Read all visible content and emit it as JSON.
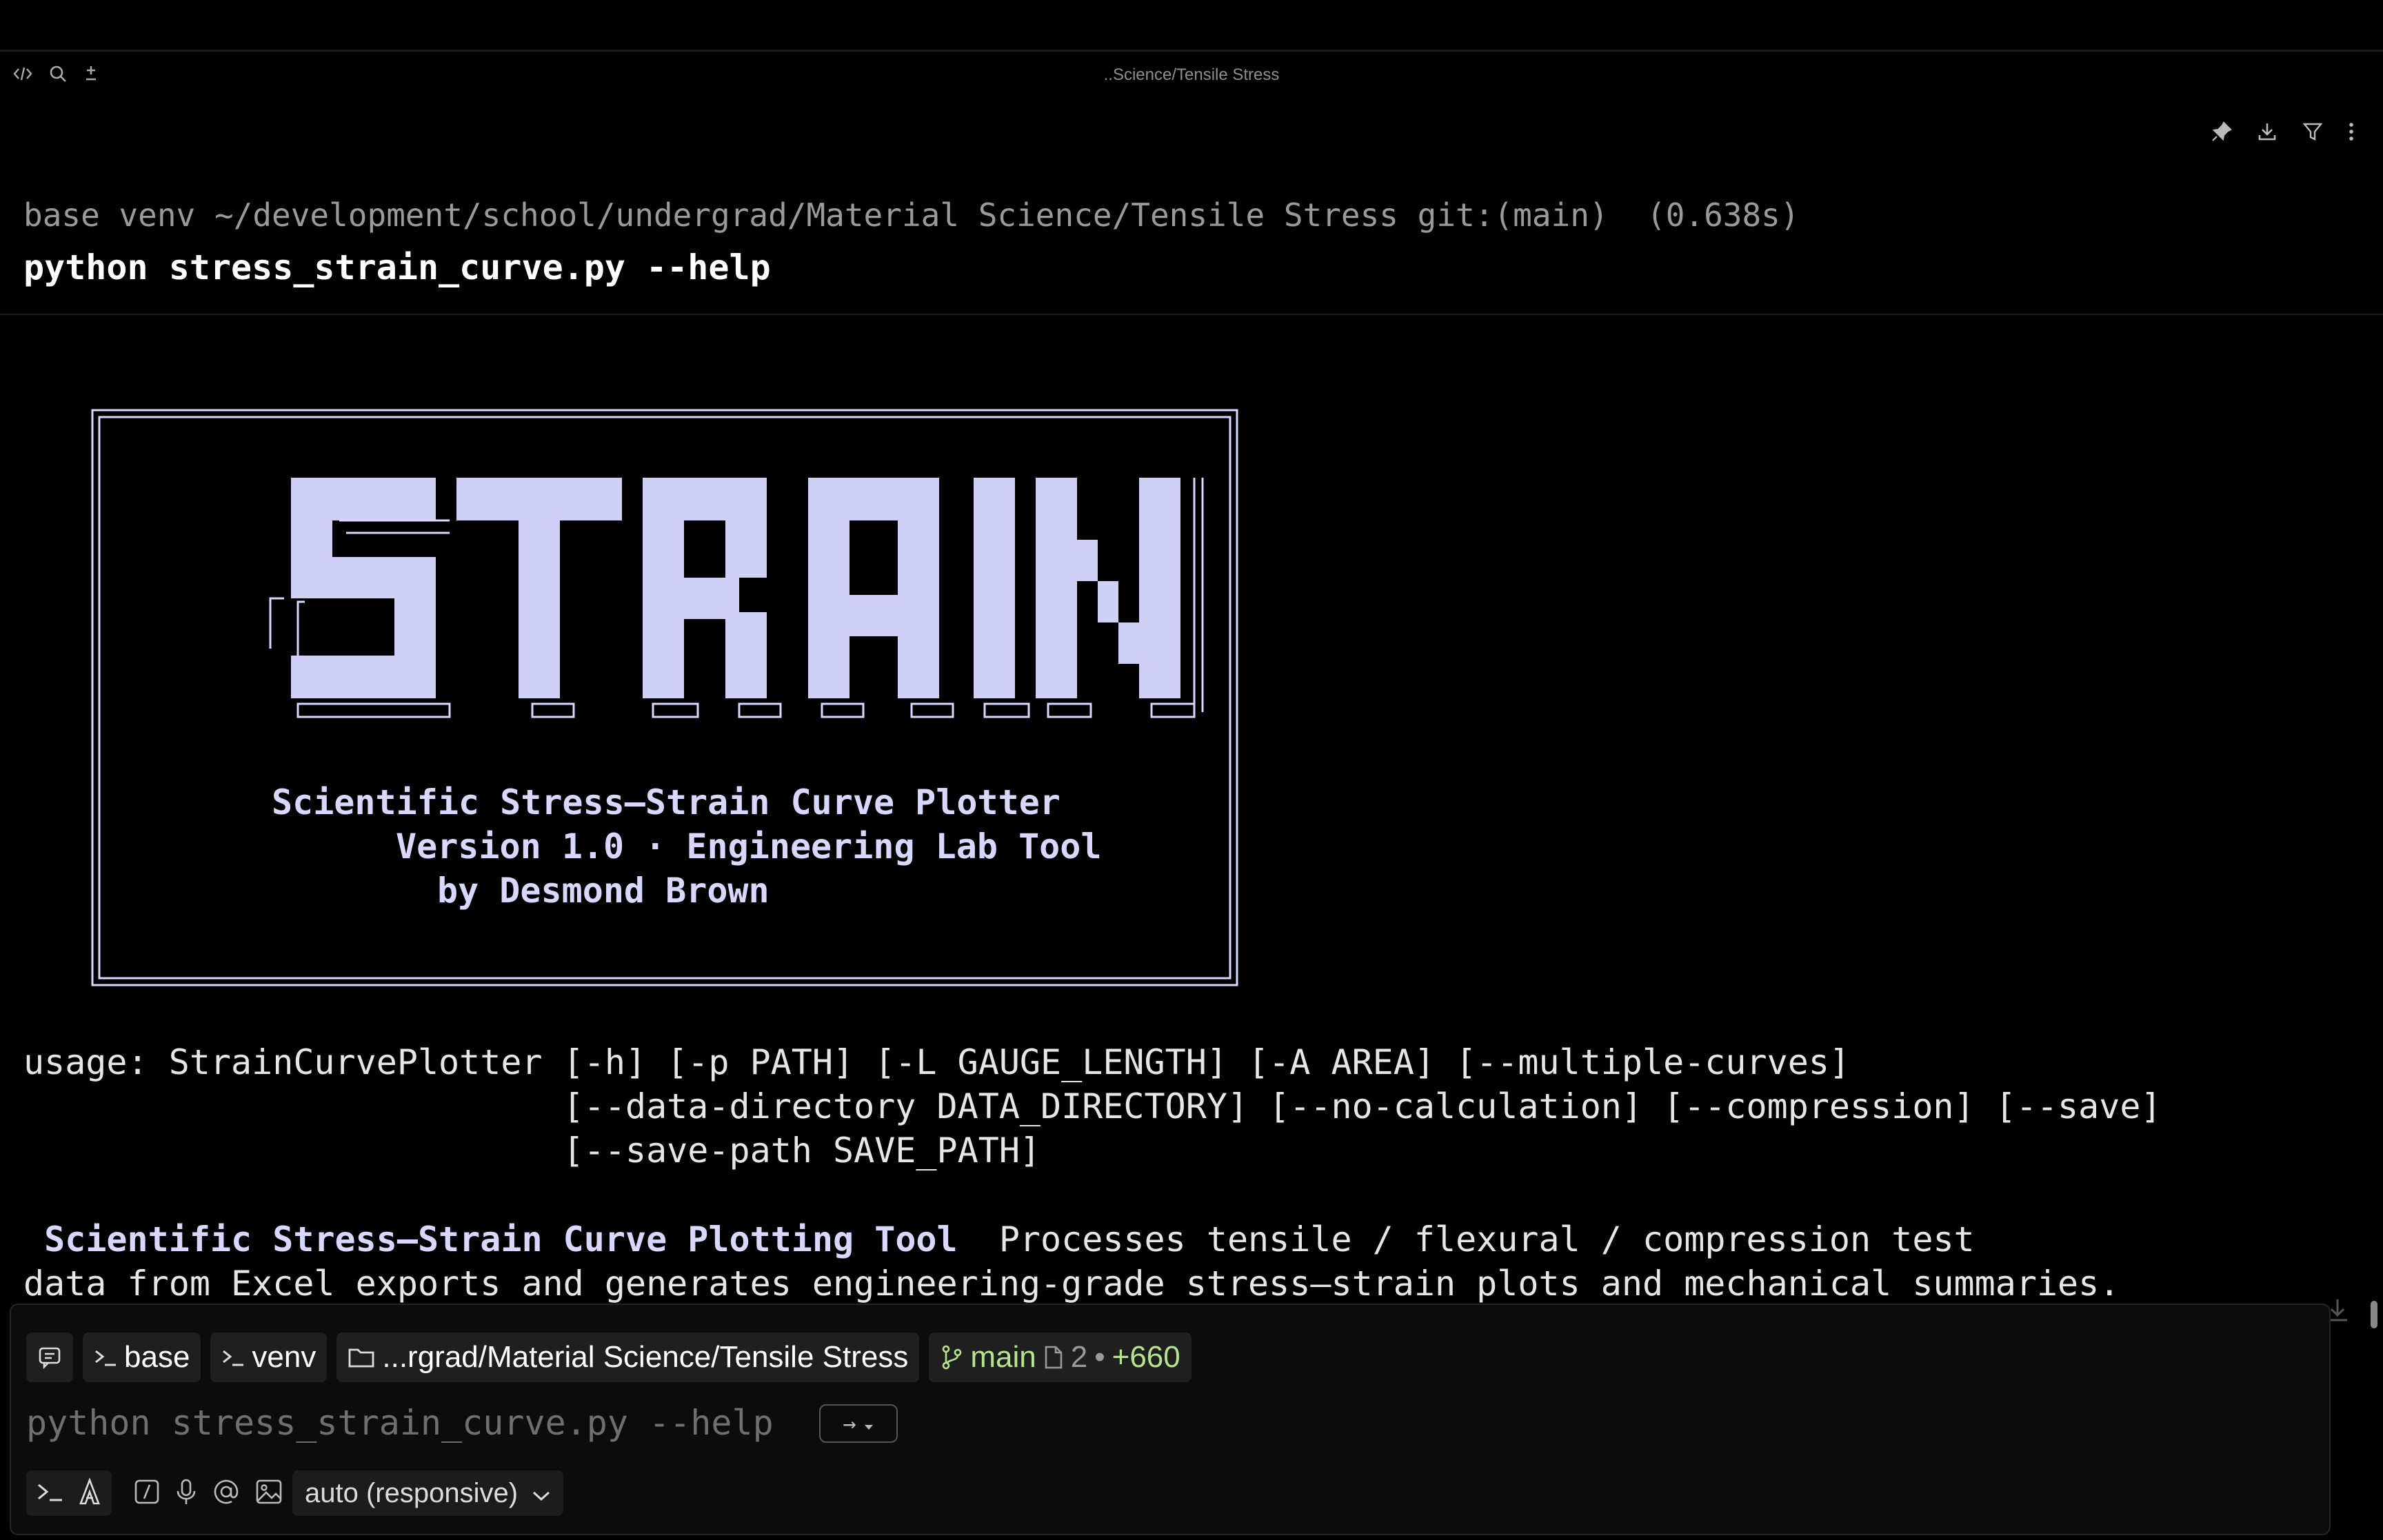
{
  "window": {
    "title": "..Science/Tensile Stress",
    "titlebar_icons": [
      "code-icon",
      "search-icon",
      "plus-minus-icon"
    ]
  },
  "block": {
    "prompt": "base venv ~/development/school/undergrad/Material Science/Tensile Stress git:(main)  (0.638s)",
    "command": "python stress_strain_curve.py --help",
    "actions": [
      "pin-icon",
      "download-icon",
      "filter-icon",
      "more-icon"
    ]
  },
  "banner": {
    "logo_text": "STRAIN",
    "line1": "Scientific Stress–Strain Curve Plotter",
    "line2": "Version 1.0 · Engineering Lab Tool",
    "line3": "by Desmond Brown"
  },
  "output": {
    "usage_1": "usage: StrainCurvePlotter [-h] [-p PATH] [-L GAUGE_LENGTH] [-A AREA] [--multiple-curves]",
    "usage_2": "                          [--data-directory DATA_DIRECTORY] [--no-calculation] [--compression] [--save]",
    "usage_3": "                          [--save-path SAVE_PATH]",
    "desc_title": "Scientific Stress–Strain Curve Plotting Tool",
    "desc_rest": "  Processes tensile / flexural / compression test",
    "desc_line2": "data from Excel exports and generates engineering-grade stress–strain plots and mechanical summaries."
  },
  "input": {
    "chips": {
      "env1": "base",
      "env2": "venv",
      "path": "...rgrad/Material Science/Tensile Stress",
      "branch": "main",
      "files": "2",
      "separator": "•",
      "added": "+660"
    },
    "text": "python stress_strain_curve.py --help",
    "route_arrow": "→",
    "model": "auto (responsive)"
  },
  "colors": {
    "banner": "#d8d8ff",
    "git_green": "#b4e58c",
    "prompt_gray": "#9a9a9a"
  }
}
